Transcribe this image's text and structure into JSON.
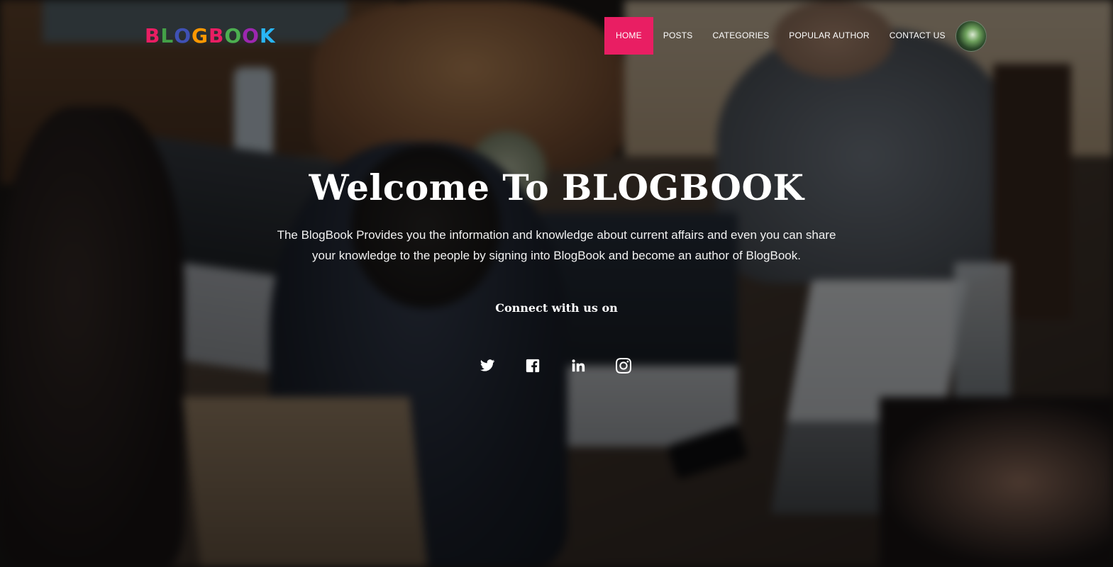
{
  "brand": {
    "letters": [
      {
        "char": "B",
        "color": "#e91e63"
      },
      {
        "char": "L",
        "color": "#43a047"
      },
      {
        "char": "O",
        "color": "#3f51b5"
      },
      {
        "char": "G",
        "color": "#ff9800"
      },
      {
        "char": "B",
        "color": "#e91e63"
      },
      {
        "char": "O",
        "color": "#4caf50"
      },
      {
        "char": "O",
        "color": "#9c27b0"
      },
      {
        "char": "K",
        "color": "#29b6f6"
      }
    ]
  },
  "nav": {
    "items": [
      {
        "label": "HOME",
        "active": true
      },
      {
        "label": "POSTS",
        "active": false
      },
      {
        "label": "CATEGORIES",
        "active": false
      },
      {
        "label": "POPULAR AUTHOR",
        "active": false
      },
      {
        "label": "CONTACT US",
        "active": false
      }
    ],
    "active_color": "#e91e63"
  },
  "hero": {
    "title": "Welcome To BLOGBOOK",
    "description": "The BlogBook Provides you the information and knowledge about current affairs and even you can share your knowledge to the people by signing into BlogBook and become an author of BlogBook.",
    "connect_label": "Connect with us on"
  },
  "social": [
    {
      "icon": "twitter-icon"
    },
    {
      "icon": "facebook-icon"
    },
    {
      "icon": "linkedin-icon"
    },
    {
      "icon": "instagram-icon"
    }
  ]
}
